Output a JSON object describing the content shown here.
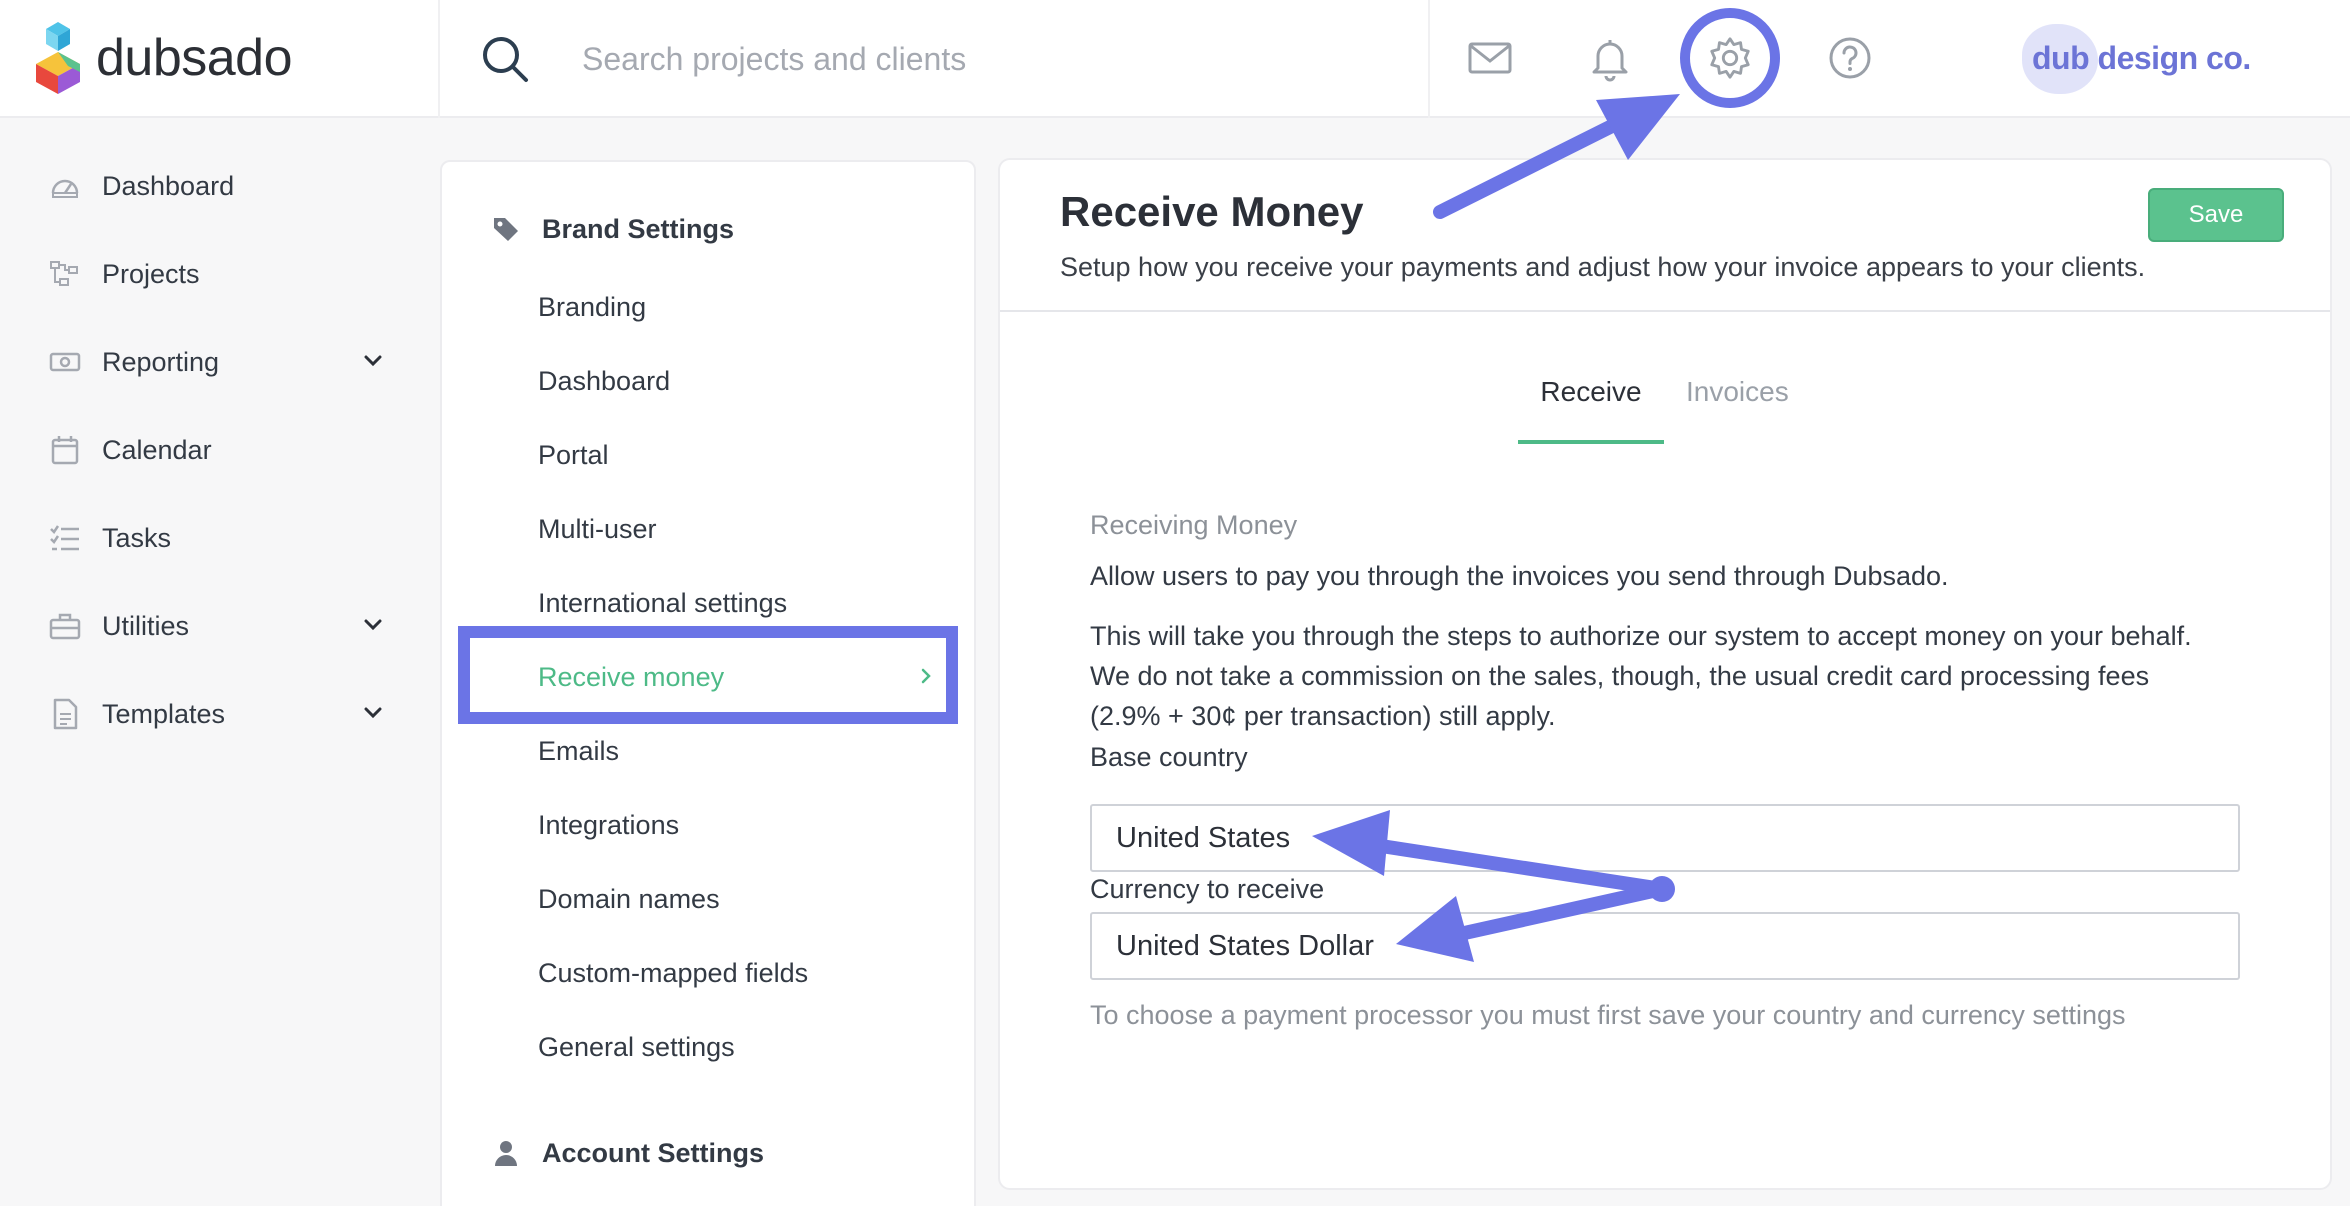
{
  "app": {
    "logo_text": "dubsado"
  },
  "search": {
    "placeholder": "Search projects and clients"
  },
  "brand": {
    "name": "dub design co."
  },
  "nav": {
    "items": [
      {
        "label": "Dashboard",
        "icon": "dashboard-icon"
      },
      {
        "label": "Projects",
        "icon": "projects-icon"
      },
      {
        "label": "Reporting",
        "icon": "reporting-icon",
        "expandable": true
      },
      {
        "label": "Calendar",
        "icon": "calendar-icon"
      },
      {
        "label": "Tasks",
        "icon": "tasks-icon"
      },
      {
        "label": "Utilities",
        "icon": "utilities-icon",
        "expandable": true
      },
      {
        "label": "Templates",
        "icon": "templates-icon",
        "expandable": true
      }
    ]
  },
  "settings_menu": {
    "brand_section": "Brand Settings",
    "items": [
      "Branding",
      "Dashboard",
      "Portal",
      "Multi-user",
      "International settings",
      "Receive money",
      "Emails",
      "Integrations",
      "Domain names",
      "Custom-mapped fields",
      "General settings"
    ],
    "active_item": "Receive money",
    "account_section": "Account Settings"
  },
  "page": {
    "title": "Receive Money",
    "subtitle": "Setup how you receive your payments and adjust how your invoice appears to your clients.",
    "save_label": "Save",
    "tabs": [
      "Receive",
      "Invoices"
    ],
    "active_tab": "Receive",
    "caption": "Receiving Money",
    "intro": "Allow users to pay you through the invoices you send through Dubsado.",
    "details": [
      "This will take you through the steps to authorize our system to accept money on your behalf.",
      "We do not take a commission on the sales, though, the usual credit card processing fees",
      "(2.9% + 30¢ per transaction) still apply."
    ],
    "base_country_label": "Base country",
    "base_country_value": "United States",
    "currency_label": "Currency to receive",
    "currency_value": "United States Dollar",
    "hint": "To choose a payment processor you must first save your country and currency settings"
  },
  "colors": {
    "accent_green": "#4dba87",
    "annotation_blue": "#6b74e6",
    "save_button": "#5bc28e"
  }
}
